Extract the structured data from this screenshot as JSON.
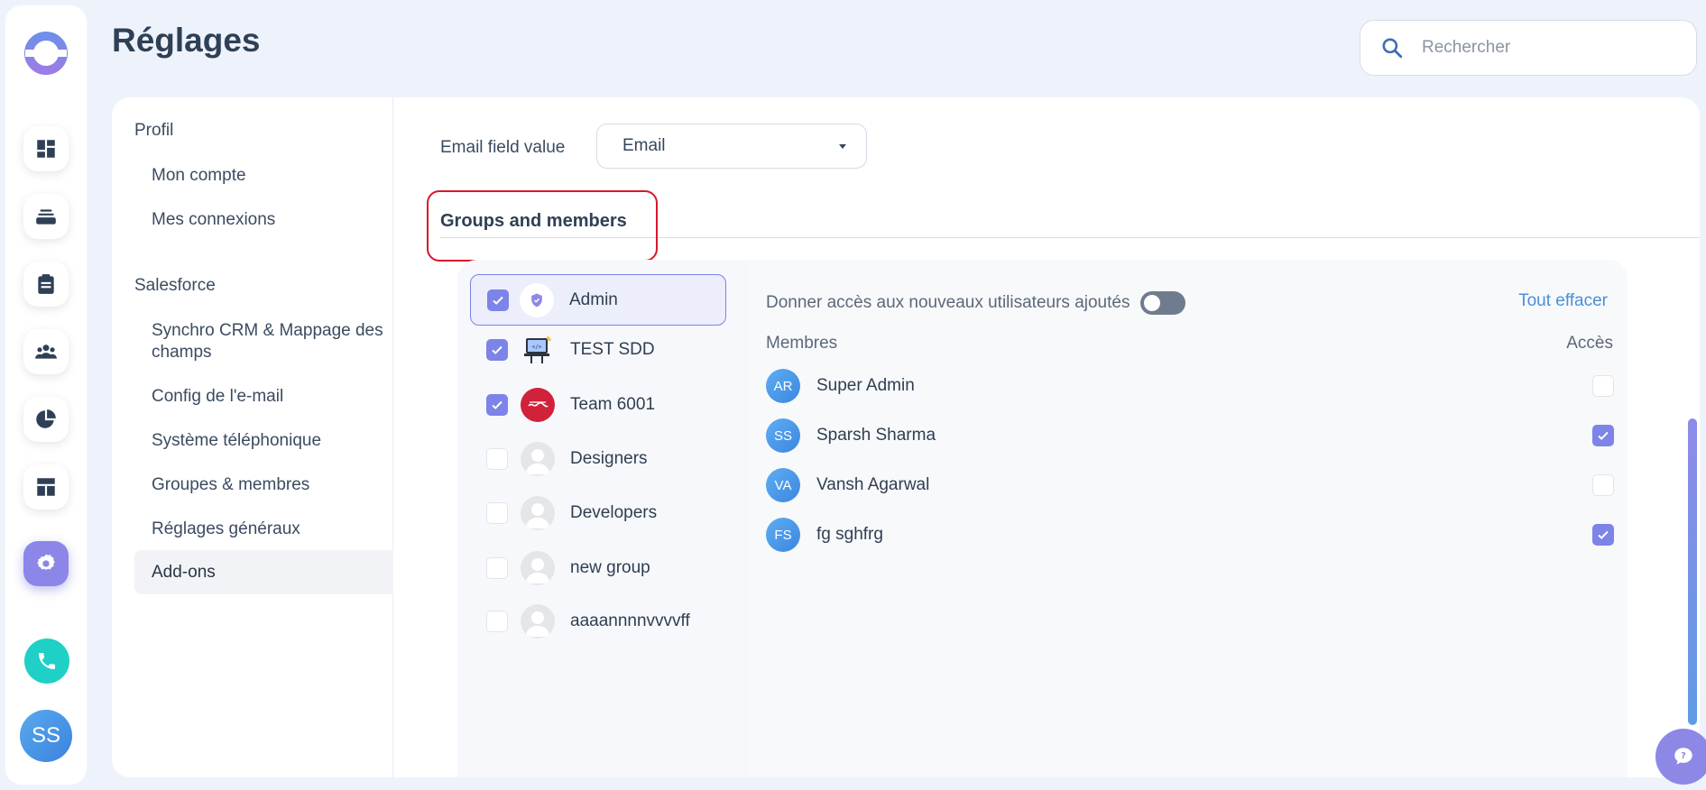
{
  "header": {
    "title": "Réglages",
    "search_placeholder": "Rechercher"
  },
  "rail": {
    "items": [
      {
        "icon": "dashboard-icon"
      },
      {
        "icon": "inbox-stack-icon"
      },
      {
        "icon": "clipboard-icon"
      },
      {
        "icon": "team-icon"
      },
      {
        "icon": "pie-chart-icon"
      },
      {
        "icon": "layout-icon"
      },
      {
        "icon": "gear-icon",
        "active": true
      }
    ],
    "user_initials": "SS"
  },
  "settings_nav": {
    "profile_heading": "Profil",
    "profile_items": [
      "Mon compte",
      "Mes connexions"
    ],
    "salesforce_heading": "Salesforce",
    "salesforce_items": [
      "Synchro CRM & Mappage des champs",
      "Config de l'e-mail",
      "Système téléphonique",
      "Groupes & membres",
      "Réglages généraux",
      "Add-ons"
    ],
    "active_item": "Add-ons"
  },
  "email_field": {
    "label": "Email field value",
    "value": "Email"
  },
  "section_title": "Groups and members",
  "groups": [
    {
      "name": "Admin",
      "checked": true,
      "selected": true
    },
    {
      "name": "TEST SDD",
      "checked": true
    },
    {
      "name": "Team 6001",
      "checked": true
    },
    {
      "name": "Designers",
      "checked": false
    },
    {
      "name": "Developers",
      "checked": false
    },
    {
      "name": "new group",
      "checked": false
    },
    {
      "name": "aaaannnnvvvvff",
      "checked": false
    }
  ],
  "members_panel": {
    "grant_access_label": "Donner accès aux nouveaux utilisateurs ajoutés",
    "grant_access_on": false,
    "clear_all": "Tout effacer",
    "col_members": "Membres",
    "col_access": "Accès",
    "members": [
      {
        "initials": "AR",
        "name": "Super Admin",
        "access": false
      },
      {
        "initials": "SS",
        "name": "Sparsh Sharma",
        "access": true
      },
      {
        "initials": "VA",
        "name": "Vansh Agarwal",
        "access": false
      },
      {
        "initials": "FS",
        "name": "fg sghfrg",
        "access": true
      }
    ]
  },
  "colors": {
    "accent": "#7c84e8",
    "highlight_box": "#d6182b",
    "link": "#4a8fd8"
  }
}
